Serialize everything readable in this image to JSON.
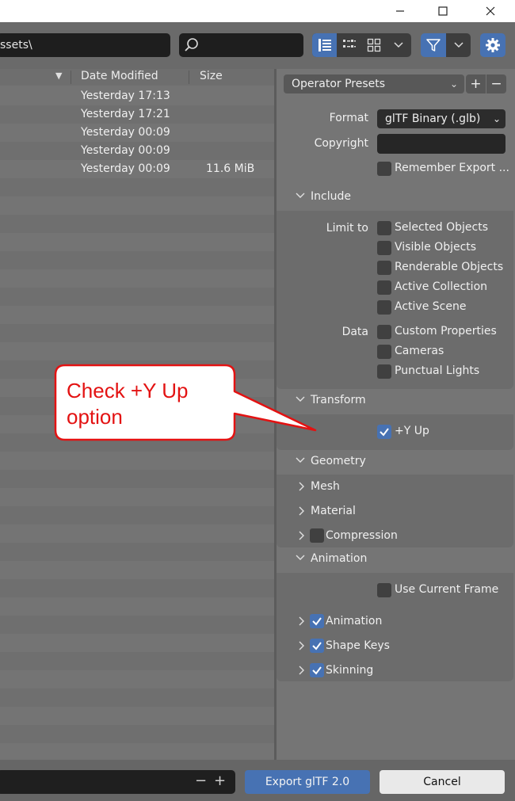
{
  "window": {
    "minimize_glyph": "—",
    "maximize_glyph": "☐",
    "close_glyph": "✕"
  },
  "toolbar": {
    "path_value": "ssets\\",
    "search_placeholder": "",
    "view_modes": [
      "vertical-list-icon",
      "horizontal-list-icon",
      "thumbnails-icon"
    ],
    "view_dropdown_glyph": "⌄",
    "filter_dropdown_glyph": "⌄"
  },
  "filelist": {
    "sort_glyph": "▼",
    "columns": {
      "date": "Date Modified",
      "size": "Size"
    },
    "rows": [
      {
        "date": "Yesterday 17:13",
        "size": ""
      },
      {
        "date": "Yesterday 17:21",
        "size": ""
      },
      {
        "date": "Yesterday 00:09",
        "size": ""
      },
      {
        "date": "Yesterday 00:09",
        "size": ""
      },
      {
        "date": "Yesterday 00:09",
        "size": "11.6 MiB"
      }
    ]
  },
  "panel": {
    "presets_label": "Operator Presets",
    "preset_add": "+",
    "preset_remove": "−",
    "format_label": "Format",
    "format_value": "glTF Binary (.glb)",
    "copyright_label": "Copyright",
    "copyright_value": "",
    "remember_label": "Remember Export ...",
    "include": {
      "title": "Include",
      "limit_label": "Limit to",
      "limit_items": [
        "Selected Objects",
        "Visible Objects",
        "Renderable Objects",
        "Active Collection",
        "Active Scene"
      ],
      "data_label": "Data",
      "data_items": [
        "Custom Properties",
        "Cameras",
        "Punctual Lights"
      ]
    },
    "transform": {
      "title": "Transform",
      "yup_label": "+Y Up",
      "yup_checked": true
    },
    "geometry": {
      "title": "Geometry",
      "mesh": "Mesh",
      "material": "Material",
      "compression": "Compression"
    },
    "animation": {
      "title": "Animation",
      "use_current_frame": "Use Current Frame",
      "animation": "Animation",
      "shape_keys": "Shape Keys",
      "skinning": "Skinning"
    }
  },
  "bottom": {
    "minus": "−",
    "plus": "+",
    "export_label": "Export glTF 2.0",
    "cancel_label": "Cancel"
  },
  "callout": {
    "text_line1": "Check +Y Up",
    "text_line2": "option",
    "color": "#e31212"
  },
  "colors": {
    "accent": "#4772b3",
    "panel_bg": "#757575",
    "field_dark": "#2c2c2c"
  }
}
